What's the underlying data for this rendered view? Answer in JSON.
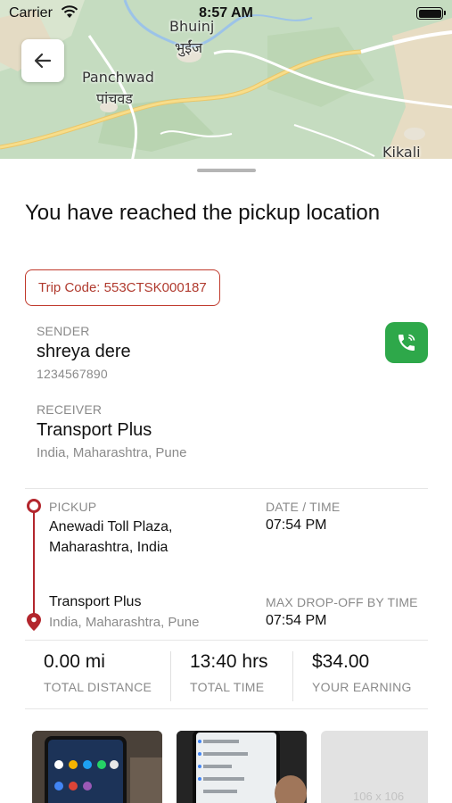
{
  "status_bar": {
    "carrier": "Carrier",
    "time": "8:57 AM"
  },
  "map": {
    "labels": {
      "bhuinj_en": "Bhuinj",
      "bhuinj_mr": "भुईंज",
      "panchwad_en": "Panchwad",
      "panchwad_mr": "पांचवड",
      "kikali": "Kikali"
    }
  },
  "title": "You have reached the pickup location",
  "trip_code": "Trip Code: 553CTSK000187",
  "sender": {
    "label": "SENDER",
    "name": "shreya dere",
    "phone": "1234567890"
  },
  "receiver": {
    "label": "RECEIVER",
    "name": "Transport Plus",
    "address": "India, Maharashtra, Pune"
  },
  "pickup": {
    "label": "PICKUP",
    "address": "Anewadi Toll Plaza, Maharashtra, India"
  },
  "date_time": {
    "label": "DATE / TIME",
    "value": "07:54 PM"
  },
  "dropoff": {
    "name": "Transport Plus",
    "address": "India, Maharashtra, Pune"
  },
  "max_dropoff": {
    "label": "MAX DROP-OFF BY TIME",
    "value": "07:54 PM"
  },
  "stats": [
    {
      "value": "0.00 mi",
      "label": "TOTAL DISTANCE"
    },
    {
      "value": "13:40 hrs",
      "label": "TOTAL TIME"
    },
    {
      "value": "$34.00",
      "label": "YOUR EARNING"
    }
  ],
  "photos": {
    "placeholder_text": "106 x 106"
  },
  "colors": {
    "accent_red": "#b3262d",
    "call_green": "#2ea84a"
  },
  "icons": [
    "wifi-icon",
    "battery-icon",
    "back-arrow-icon",
    "phone-icon",
    "location-pin-icon"
  ]
}
